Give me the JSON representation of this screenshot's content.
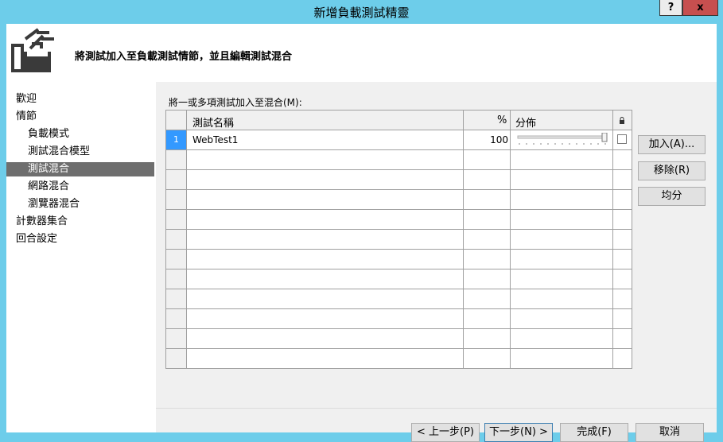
{
  "window": {
    "title": "新增負載測試精靈",
    "help_label": "?",
    "close_label": "x"
  },
  "header": {
    "text": "將測試加入至負載測試情節，並且編輯測試混合"
  },
  "sidebar": {
    "items": [
      {
        "label": "歡迎",
        "level": 1
      },
      {
        "label": "情節",
        "level": 1
      },
      {
        "label": "負載模式",
        "level": 2
      },
      {
        "label": "測試混合模型",
        "level": 2
      },
      {
        "label": "測試混合",
        "level": 2,
        "selected": true
      },
      {
        "label": "網路混合",
        "level": 2
      },
      {
        "label": "瀏覽器混合",
        "level": 2
      },
      {
        "label": "計數器集合",
        "level": 1
      },
      {
        "label": "回合設定",
        "level": 1
      }
    ]
  },
  "grid": {
    "label": "將一或多項測試加入至混合(M):",
    "headers": {
      "name": "測試名稱",
      "percent": "%",
      "distribution": "分佈",
      "lock_icon": "lock-icon"
    },
    "rows": [
      {
        "num": "1",
        "name": "WebTest1",
        "percent": "100",
        "slider_fraction": 1.0,
        "locked": false
      }
    ],
    "empty_rows": 11
  },
  "buttons": {
    "add": "加入(A)...",
    "remove": "移除(R)",
    "distribute": "均分",
    "previous": "< 上一步(P)",
    "next": "下一步(N) >",
    "finish": "完成(F)",
    "cancel": "取消"
  },
  "colors": {
    "title_bar": "#6dcdea",
    "selected_nav": "#6e6e6e",
    "selected_row": "#3399ff",
    "close_button": "#c74f4f"
  }
}
